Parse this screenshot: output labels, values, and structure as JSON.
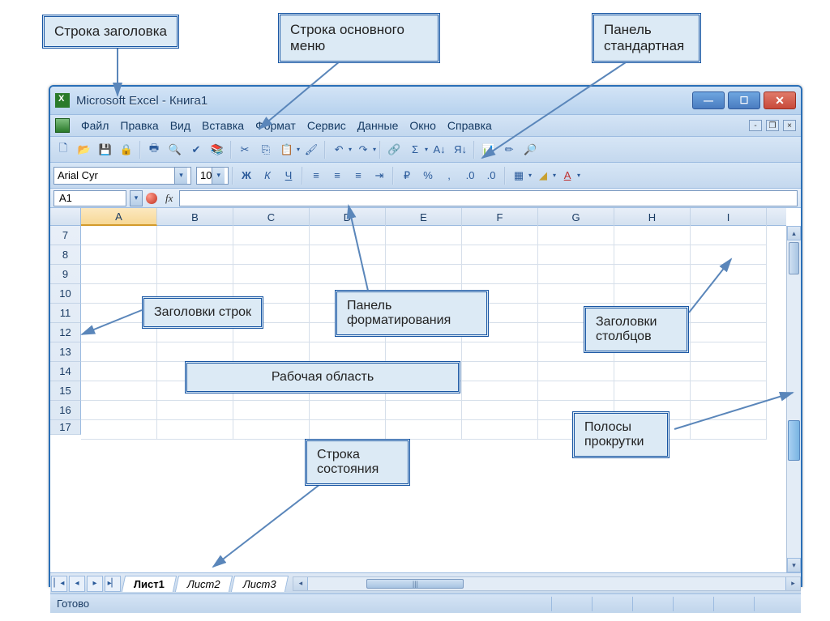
{
  "callouts": {
    "title_row": "Строка заголовка",
    "menu_row": "Строка основного меню",
    "standard_panel": "Панель стандартная",
    "row_headers": "Заголовки строк",
    "format_panel": "Панель форматирования",
    "col_headers": "Заголовки столбцов",
    "work_area": "Рабочая область",
    "status_row": "Строка состояния",
    "scrollbars": "Полосы прокрутки"
  },
  "window": {
    "title": "Microsoft Excel - Книга1"
  },
  "menu": {
    "file": "Файл",
    "edit": "Правка",
    "view": "Вид",
    "insert": "Вставка",
    "format": "Формат",
    "tools": "Сервис",
    "data": "Данные",
    "window": "Окно",
    "help": "Справка"
  },
  "formatting": {
    "font_name": "Arial Cyr",
    "font_size": "10",
    "bold": "Ж",
    "italic": "К",
    "underline": "Ч"
  },
  "name_box": "A1",
  "fx_label": "fx",
  "columns": [
    "A",
    "B",
    "C",
    "D",
    "E",
    "F",
    "G",
    "H",
    "I"
  ],
  "rows": [
    "7",
    "8",
    "9",
    "10",
    "11",
    "12",
    "13",
    "14",
    "15",
    "16",
    "17"
  ],
  "sheets": {
    "s1": "Лист1",
    "s2": "Лист2",
    "s3": "Лист3"
  },
  "status": {
    "ready": "Готово"
  },
  "hscroll_thumb": "|||"
}
